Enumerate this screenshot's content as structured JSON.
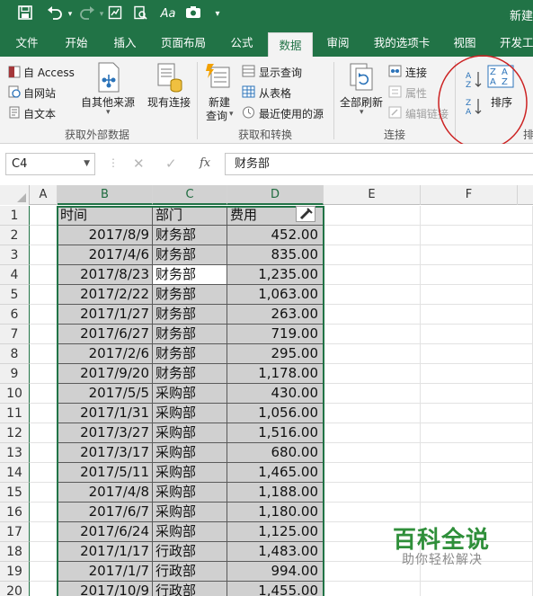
{
  "window": {
    "title": "新建"
  },
  "quick_access": {
    "save_icon": "save-icon",
    "undo_icon": "undo-icon",
    "redo_icon": "redo-icon",
    "more_label": "Aa"
  },
  "tabs": [
    {
      "label": "文件"
    },
    {
      "label": "开始"
    },
    {
      "label": "插入"
    },
    {
      "label": "页面布局"
    },
    {
      "label": "公式"
    },
    {
      "label": "数据",
      "active": true
    },
    {
      "label": "审阅"
    },
    {
      "label": "我的选项卡"
    },
    {
      "label": "视图"
    },
    {
      "label": "开发工"
    }
  ],
  "ribbon": {
    "get_external": {
      "access": "自 Access",
      "web": "自网站",
      "text": "自文本",
      "other": "自其他来源",
      "existing": "现有连接",
      "group": "获取外部数据"
    },
    "get_transform": {
      "new_query_line1": "新建",
      "new_query_line2": "查询",
      "show_queries": "显示查询",
      "from_table": "从表格",
      "recent_sources": "最近使用的源",
      "group": "获取和转换"
    },
    "connections": {
      "refresh_all": "全部刷新",
      "connections": "连接",
      "properties": "属性",
      "edit_links": "编辑链接",
      "group": "连接"
    },
    "sort_filter": {
      "sort": "排序",
      "group_partial": "排"
    },
    "highlight_color": "#cc2222"
  },
  "formula_bar": {
    "name_box": "C4",
    "fx": "fx",
    "formula": "财务部"
  },
  "grid": {
    "columns": [
      "A",
      "B",
      "C",
      "D",
      "E",
      "F"
    ],
    "selected_columns": [
      "B",
      "C",
      "D"
    ],
    "rows": [
      {
        "n": "1",
        "b": "时间",
        "c": "部门",
        "d": "费用"
      },
      {
        "n": "2",
        "b": "2017/8/9",
        "c": "财务部",
        "d": "452.00"
      },
      {
        "n": "3",
        "b": "2017/4/6",
        "c": "财务部",
        "d": "835.00"
      },
      {
        "n": "4",
        "b": "2017/8/23",
        "c": "财务部",
        "d": "1,235.00"
      },
      {
        "n": "5",
        "b": "2017/2/22",
        "c": "财务部",
        "d": "1,063.00"
      },
      {
        "n": "6",
        "b": "2017/1/27",
        "c": "财务部",
        "d": "263.00"
      },
      {
        "n": "7",
        "b": "2017/6/27",
        "c": "财务部",
        "d": "719.00"
      },
      {
        "n": "8",
        "b": "2017/2/6",
        "c": "财务部",
        "d": "295.00"
      },
      {
        "n": "9",
        "b": "2017/9/20",
        "c": "财务部",
        "d": "1,178.00"
      },
      {
        "n": "10",
        "b": "2017/5/5",
        "c": "采购部",
        "d": "430.00"
      },
      {
        "n": "11",
        "b": "2017/1/31",
        "c": "采购部",
        "d": "1,056.00"
      },
      {
        "n": "12",
        "b": "2017/3/27",
        "c": "采购部",
        "d": "1,516.00"
      },
      {
        "n": "13",
        "b": "2017/3/17",
        "c": "采购部",
        "d": "680.00"
      },
      {
        "n": "14",
        "b": "2017/5/11",
        "c": "采购部",
        "d": "1,465.00"
      },
      {
        "n": "15",
        "b": "2017/4/8",
        "c": "采购部",
        "d": "1,188.00"
      },
      {
        "n": "16",
        "b": "2017/6/7",
        "c": "采购部",
        "d": "1,180.00"
      },
      {
        "n": "17",
        "b": "2017/6/24",
        "c": "采购部",
        "d": "1,125.00"
      },
      {
        "n": "18",
        "b": "2017/1/17",
        "c": "行政部",
        "d": "1,483.00"
      },
      {
        "n": "19",
        "b": "2017/1/7",
        "c": "行政部",
        "d": "994.00"
      },
      {
        "n": "20",
        "b": "2017/10/9",
        "c": "行政部",
        "d": "1,455.00"
      }
    ],
    "active_cell": "C4",
    "selection_fill": "#d0d0d0",
    "accent": "#217346"
  },
  "watermark": {
    "title": "百科全说",
    "subtitle": "助你轻松解决"
  }
}
